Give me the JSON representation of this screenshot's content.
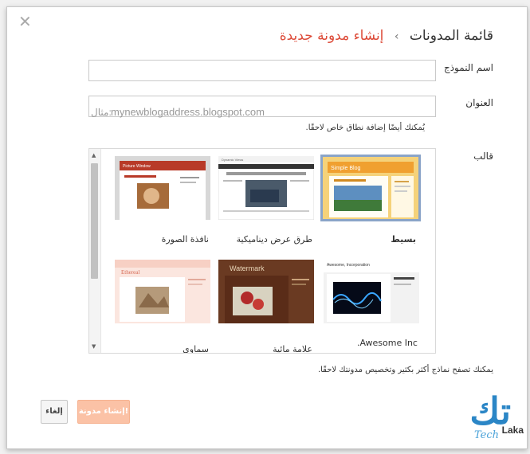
{
  "dialog": {
    "close_glyph": "✕",
    "breadcrumb_root": "قائمة المدونات",
    "breadcrumb_sep": "›",
    "breadcrumb_current": "إنشاء مدونة جديدة"
  },
  "form": {
    "name_label": "اسم النموذج",
    "name_value": "",
    "address_label": "العنوان",
    "address_prefix": "مثال:",
    "address_placeholder": "mynewblogaddress.blogspot.com",
    "address_hint": "يُمكنك أيضًا إضافة نطاق خاص لاحقًا.",
    "template_label": "قالب"
  },
  "templates": [
    {
      "name": "بسيط",
      "selected": true,
      "theme": "simple-blog",
      "header_text": "Simple Blog",
      "accent": "#f0a030"
    },
    {
      "name": "طرق عرض ديناميكية",
      "selected": false,
      "theme": "dynamic-views",
      "header_text": "Dynamic Views",
      "accent": "#333333"
    },
    {
      "name": "نافذة الصورة",
      "selected": false,
      "theme": "picture-window",
      "header_text": "Picture Window",
      "accent": "#b83a28"
    },
    {
      "name": "Awesome Inc.",
      "selected": false,
      "theme": "awesome-inc",
      "header_text": "Awesome, Incorporation",
      "accent": "#1a1a1a"
    },
    {
      "name": "علامة مائية",
      "selected": false,
      "theme": "watermark",
      "header_text": "Watermark",
      "accent": "#5a2c18"
    },
    {
      "name": "سماوي",
      "selected": false,
      "theme": "ethereal",
      "header_text": "Ethereal",
      "accent": "#f6d2c8"
    }
  ],
  "gallery_note": "يمكنك تصفح نماذج أكثر بكثير وتخصيص مدونتك لاحقًا.",
  "buttons": {
    "create_label": "إنشاء مدونة!",
    "cancel_label": "إلغاء"
  },
  "watermark_logo": {
    "letter": "تك",
    "word1": "Tech",
    "word2": "Laka"
  }
}
